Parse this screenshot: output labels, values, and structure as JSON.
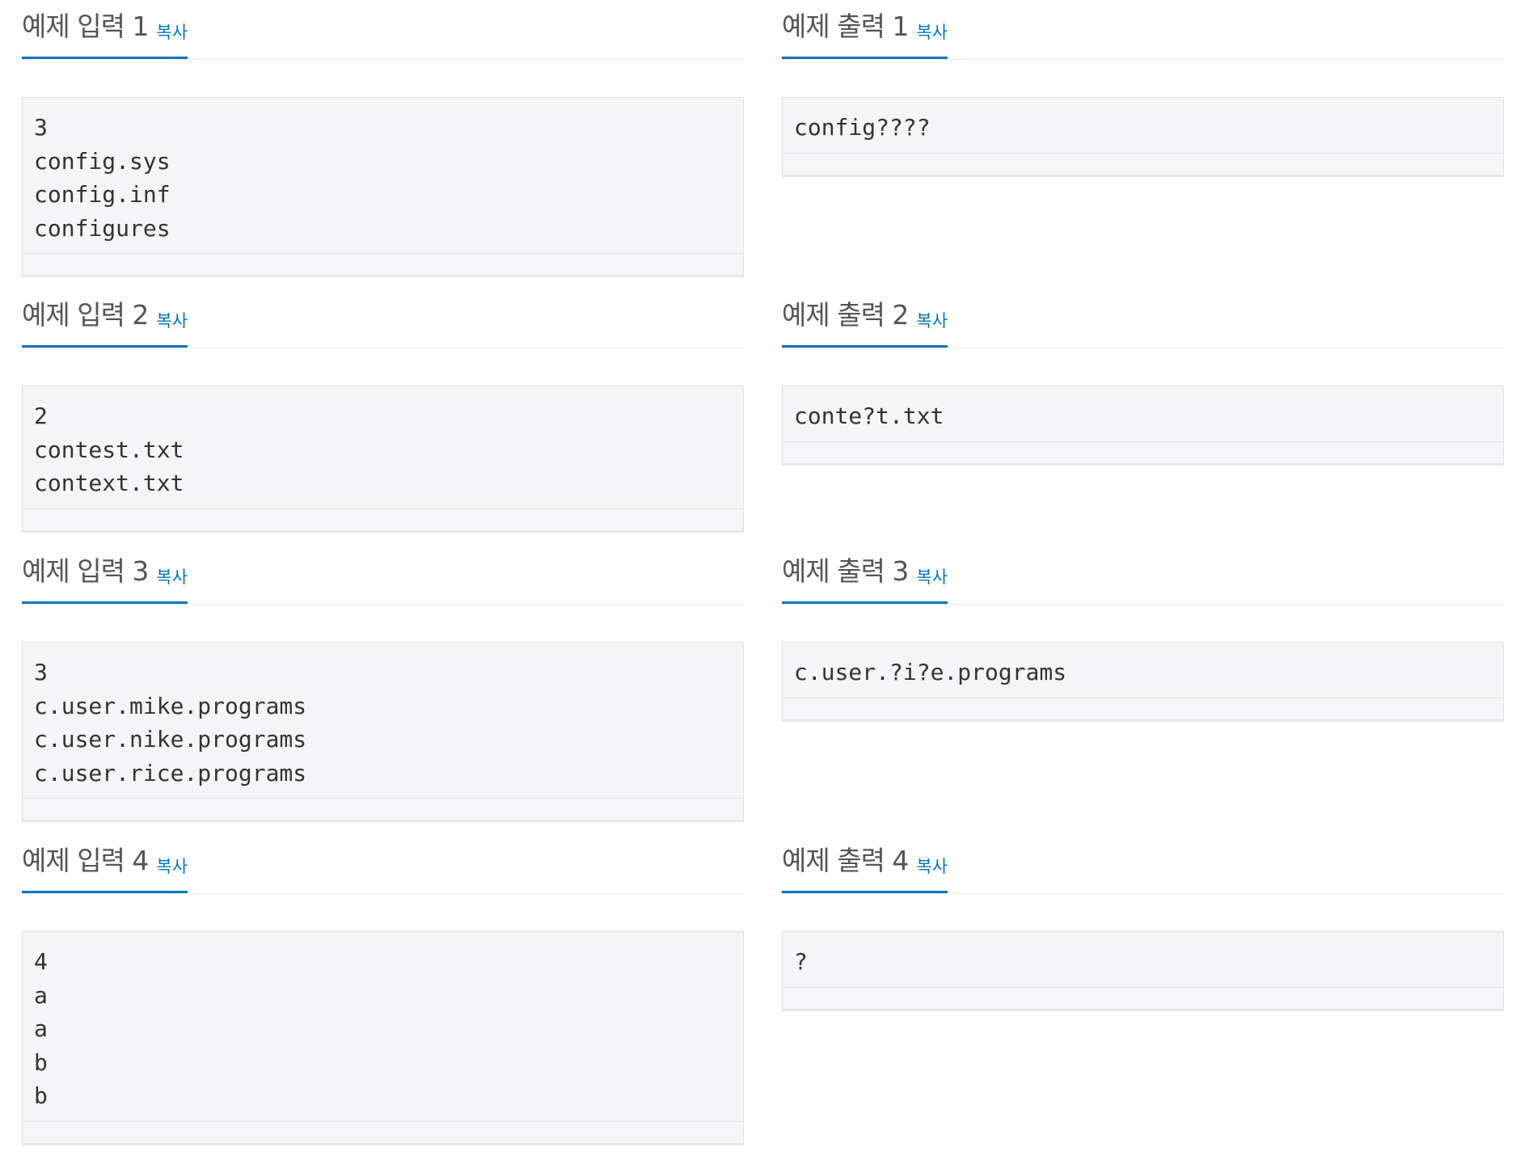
{
  "copy_label": "복사",
  "examples": [
    {
      "input_title": "예제 입력 1",
      "output_title": "예제 출력 1",
      "input": "3\nconfig.sys\nconfig.inf\nconfigures",
      "output": "config????"
    },
    {
      "input_title": "예제 입력 2",
      "output_title": "예제 출력 2",
      "input": "2\ncontest.txt\ncontext.txt",
      "output": "conte?t.txt"
    },
    {
      "input_title": "예제 입력 3",
      "output_title": "예제 출력 3",
      "input": "3\nc.user.mike.programs\nc.user.nike.programs\nc.user.rice.programs",
      "output": "c.user.?i?e.programs"
    },
    {
      "input_title": "예제 입력 4",
      "output_title": "예제 출력 4",
      "input": "4\na\na\nb\nb",
      "output": "?"
    }
  ]
}
